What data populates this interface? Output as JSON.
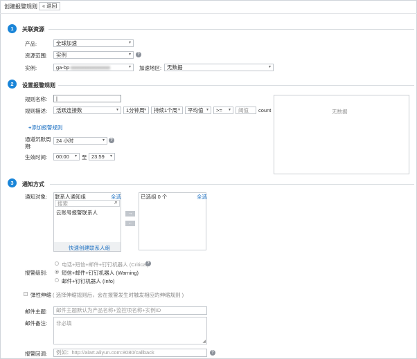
{
  "header": {
    "title": "创建报警规则",
    "back_label": "返回"
  },
  "section1": {
    "number": "1",
    "title": "关联资源",
    "product_label": "产品:",
    "product_value": "全球加速",
    "scope_label": "资源范围:",
    "scope_value": "实例",
    "instance_label": "实例:",
    "instance_value": "ga-bp",
    "region_label": "加速地区:",
    "region_value": "无数据"
  },
  "section2": {
    "number": "2",
    "title": "设置报警规则",
    "rule_name_label": "规则名称:",
    "rule_name_value": "",
    "rule_desc_label": "规则描述:",
    "metric": "活跃连接数",
    "period": "1分钟周",
    "duration": "持续1个周",
    "stat": "平均值",
    "operator": ">=",
    "threshold_placeholder": "阈值",
    "unit": "count",
    "no_data": "无数据",
    "add_rule": "添加报警规则",
    "silence_label_1": "通道沉默周",
    "silence_label_2": "期:",
    "silence_value": "24 小时",
    "effective_label": "生效时间:",
    "start_time": "00:00",
    "to": "至",
    "end_time": "23:59"
  },
  "section3": {
    "number": "3",
    "title": "通知方式",
    "target_label": "通知对象:",
    "group_header": "联系人通知组",
    "select_all": "全选",
    "search_placeholder": "搜索",
    "group_item": "云账号报警联系人",
    "quick_create": "快速创建联系人组",
    "selected_header": "已选组 0 个",
    "selected_all": "全选",
    "level_label": "报警级别:",
    "level_critical": "电话+短信+邮件+钉钉机器人 (Critical)",
    "level_warning": "短信+邮件+钉钉机器人 (Warning)",
    "level_info": "邮件+钉钉机器人 (Info)",
    "elastic_label": "弹性伸缩",
    "elastic_hint": "( 选择伸缩规则后，会在报警发生时触发相应的伸缩规则 )",
    "email_subject_label": "邮件主题:",
    "email_subject_placeholder": "邮件主题默认为产品名称+监控项名称+实例ID",
    "email_note_label": "邮件备注:",
    "email_note_placeholder": "非必填",
    "callback_label": "报警回调:",
    "callback_placeholder": "例如：http://alart.aliyun.com:8080/callback"
  },
  "colors": {
    "accent": "#1a85d8",
    "link": "#1a6fc2"
  }
}
